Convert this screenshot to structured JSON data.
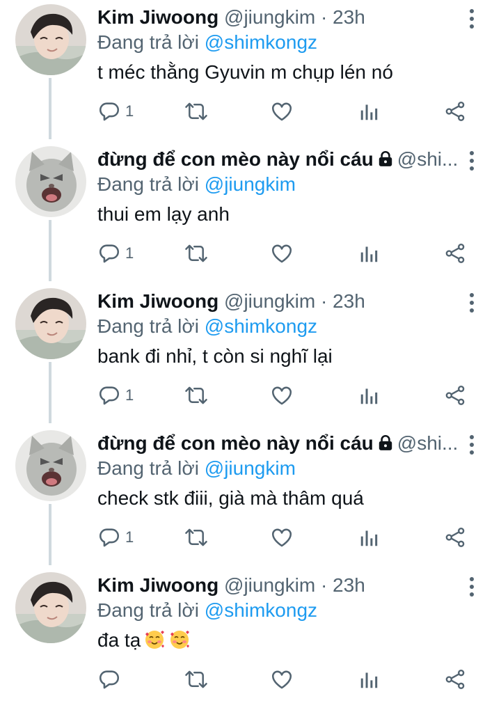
{
  "tweets": [
    {
      "id": "t1",
      "avatar": "boy-avatar",
      "name": "Kim Jiwoong",
      "handle": "@jiungkim",
      "dot": "·",
      "time": "23h",
      "locked": false,
      "reply_prefix": "Đang trả lời",
      "reply_to": "@shimkongz",
      "text": "t méc thằng Gyuvin m chụp lén nó",
      "reply_count": "1"
    },
    {
      "id": "t2",
      "avatar": "cat-avatar",
      "name": "đừng để con mèo này nổi cáu",
      "handle": "@shi...",
      "dot": "",
      "time": "",
      "locked": true,
      "reply_prefix": "Đang trả lời",
      "reply_to": "@jiungkim",
      "text": "thui em lạy anh",
      "reply_count": "1"
    },
    {
      "id": "t3",
      "avatar": "boy-avatar",
      "name": "Kim Jiwoong",
      "handle": "@jiungkim",
      "dot": "·",
      "time": "23h",
      "locked": false,
      "reply_prefix": "Đang trả lời",
      "reply_to": "@shimkongz",
      "text": "bank đi nhỉ, t còn si nghĩ lại",
      "reply_count": "1"
    },
    {
      "id": "t4",
      "avatar": "cat-avatar",
      "name": "đừng để con mèo này nổi cáu",
      "handle": "@shi...",
      "dot": "",
      "time": "",
      "locked": true,
      "reply_prefix": "Đang trả lời",
      "reply_to": "@jiungkim",
      "text": "check stk điii, già mà thâm quá",
      "reply_count": "1"
    },
    {
      "id": "t5",
      "avatar": "boy-avatar",
      "name": "Kim Jiwoong",
      "handle": "@jiungkim",
      "dot": "·",
      "time": "23h",
      "locked": false,
      "reply_prefix": "Đang trả lời",
      "reply_to": "@shimkongz",
      "text": "đa tạ",
      "emojis": [
        "smiling-face-with-hearts-emoji",
        "smiling-face-with-hearts-emoji"
      ],
      "reply_count": ""
    }
  ],
  "icons": {
    "reply": "reply-icon",
    "retweet": "retweet-icon",
    "like": "like-icon",
    "views": "views-icon",
    "share": "share-icon",
    "menu": "more-vertical-icon",
    "lock": "lock-icon"
  },
  "colors": {
    "text": "#0f1419",
    "secondary": "#536471",
    "mention": "#1d9bf0",
    "thread_line": "#cfd9de"
  }
}
